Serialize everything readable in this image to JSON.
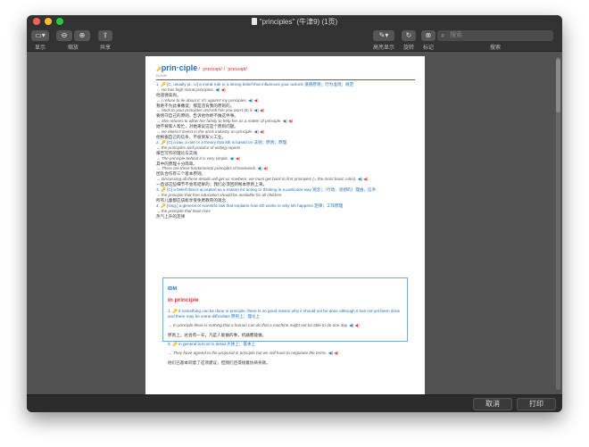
{
  "window": {
    "title": "\"principles\" (牛津9) (1页)"
  },
  "toolbar": {
    "sidebar_label": "显示",
    "zoom_label": "缩放",
    "share_label": "共享",
    "highlight_label": "高亮显示",
    "rotate_label": "旋转",
    "markup_label": "标记",
    "search_placeholder": "搜索",
    "search_label": "搜索"
  },
  "entry": {
    "headword": "prin·ciple",
    "part": "NOUN",
    "pron": "/ ˈprɪnsəpl/ / ˈprɪnsəpl/",
    "s1": "1. 🔑 [C, usually pl., U] a moral rule or a strong belief that influences your actions 道德原则；行为准则；规范",
    "s1e1": "→ He has high moral principles.",
    "s1z1": "他道德高尚。",
    "s1e2": "→ I refuse to lie about it; it's against my principles.",
    "s1z2": "我绝不为此事撒谎；那是违背我的原则的。",
    "s1e3": "→ Stick to your principles and tell him you won't do it.",
    "s1z3": "要恪守自己的原则，告诉他你绝不做这件事。",
    "s1e4": "→ She refuses to allow her family to help her as a matter of principle.",
    "s1z4": "她不要家人帮忙，对她来说这是个原则问题。",
    "s1e5": "→ He doesn't invest in the arms industry on principle.",
    "s1z5": "他根据自己的信条，不投资军火工业。",
    "s2": "2. 🔑 [C] a law, a rule or a theory that sth is based on 法则；原则；原理",
    "s2e1": "→ the principles and practice of writing reports",
    "s2z1": "报告写作的理论与实践",
    "s2e2": "→ The principle behind it is very simple.",
    "s2z2": "其中的原理十分简单。",
    "s2e3": "→ There are three fundamental principles of teamwork.",
    "s2z3": "团队合作有三个基本原则。",
    "s2e4": "→ Discussing all these details will get us nowhere; we must get back to first principles (= the most basic rules).",
    "s2z4": "一直谈这些细节不会有结果的；我们必须回到根本原则上来。",
    "s3": "3. 🔑 [C] a belief that is accepted as a reason for acting or thinking in a particular way 观念；（行动、思想的）理由，信条",
    "s3e1": "→ the principle that free education should be available for all children",
    "s3z1": "所有儿童都应该能享受免费教育的观念",
    "s4": "4. 🔑 [sing.] a general or scientific law that explains how sth works or why sth happens 定律；工作原理",
    "s4e1": "→ the principle that heat rises",
    "s4z1": "热气上升的定律"
  },
  "idm": {
    "title": "IDM",
    "headword": "in principle",
    "d1": "1. 🔑 if something can be done in principle, there is no good reason why it should not be done although it has not yet been done and there may be some difficulties 原则上；理论上",
    "d1e1": "→ In principle there is nothing that a human can do that a machine might not be able to do one day.",
    "d1z1": "原则上，总会有一天，凡是人能做的事，机器都能做。",
    "d2": "2. 🔑 in general but not in detail 大体上；基本上",
    "d2e1": "→ They have agreed to the proposal in principle but we still have to negotiate the terms.",
    "d2z1": "他们已基本同意了这项建议，但我们还得接着协商条款。"
  },
  "bottom": {
    "cancel_label": "取消",
    "print_label": "打印"
  }
}
